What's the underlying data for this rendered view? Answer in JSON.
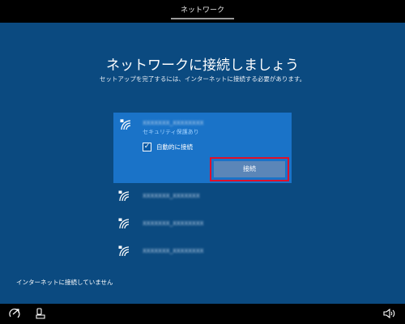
{
  "header": {
    "tab_label": "ネットワーク"
  },
  "page": {
    "title": "ネットワークに接続しましょう",
    "subtitle": "セットアップを完了するには、インターネットに接続する必要があります。"
  },
  "networks": {
    "selected": {
      "name": "XXXXXXX_XXXXXXXX",
      "status": "セキュリティ保護あり",
      "auto_connect_label": "自動的に接続",
      "auto_connect_checked": true,
      "connect_label": "接続"
    },
    "others": [
      {
        "name": "XXXXXXX_XXXXXXX"
      },
      {
        "name": "XXXXXXX_XXXXXXXX"
      },
      {
        "name": "XXXXXXX_XXXXXXXX"
      }
    ]
  },
  "footer": {
    "offline_text": "インターネットに接続していません"
  },
  "icons": {
    "wifi": "wifi-secured-icon",
    "accessibility": "ease-of-access-icon",
    "keyboard": "input-method-icon",
    "volume": "volume-icon"
  },
  "colors": {
    "background": "#0b4a80",
    "selected_item": "#1a73c8",
    "connect_button": "#5b86b8",
    "highlight_border": "#e0102a"
  }
}
